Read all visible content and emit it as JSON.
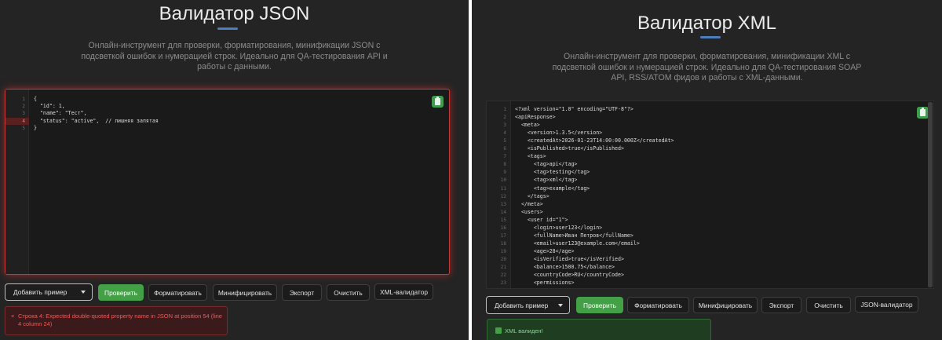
{
  "json_panel": {
    "title": "Валидатор JSON",
    "description_lines": [
      "Онлайн-инструмент для проверки, форматирования, минификации JSON с",
      "подсветкой ошибок и нумерацией строк. Идеально для QA-тестирования API и",
      "работы с данными."
    ],
    "line_numbers": [
      "1",
      "2",
      "3",
      "4",
      "5"
    ],
    "code_lines": [
      "{",
      "  \"id\": 1,",
      "  \"name\": \"Тест\",",
      "  \"status\": \"active\",  // лишняя запятая",
      "}"
    ],
    "error_line": "4",
    "select_label": "Добавить пример",
    "buttons": {
      "validate": "Проверить",
      "format": "Форматировать",
      "minify": "Минифицировать",
      "export": "Экспорт",
      "clear": "Очистить",
      "switch": "XML-валидатор"
    },
    "error_icon": "×",
    "error_lines": [
      "Строка 4: Expected double-quoted property name in JSON at position 54 (line",
      "4 column 24)"
    ]
  },
  "xml_panel": {
    "title": "Валидатор XML",
    "description_lines": [
      "Онлайн-инструмент для проверки, форматирования, минификации XML с",
      "подсветкой ошибок и нумерацией строк. Идеально для QA-тестирования SOAP",
      "API, RSS/ATOM фидов и работы с XML-данными."
    ],
    "line_numbers": [
      "1",
      "2",
      "3",
      "4",
      "5",
      "6",
      "7",
      "8",
      "9",
      "10",
      "11",
      "12",
      "13",
      "14",
      "15",
      "16",
      "17",
      "18",
      "19",
      "20",
      "21",
      "22",
      "23"
    ],
    "code_lines": [
      "<?xml version=\"1.0\" encoding=\"UTF-8\"?>",
      "<apiResponse>",
      "  <meta>",
      "    <version>1.3.5</version>",
      "    <createdAt>2026-01-23T14:00:00.000Z</createdAt>",
      "    <isPublished>true</isPublished>",
      "    <tags>",
      "      <tag>api</tag>",
      "      <tag>testing</tag>",
      "      <tag>xml</tag>",
      "      <tag>example</tag>",
      "    </tags>",
      "  </meta>",
      "  <users>",
      "    <user id=\"1\">",
      "      <login>user123</login>",
      "      <fullName>Иван Петров</fullName>",
      "      <email>user123@example.com</email>",
      "      <age>28</age>",
      "      <isVerified>true</isVerified>",
      "      <balance>1500.75</balance>",
      "      <countryCode>RU</countryCode>",
      "      <permissions>"
    ],
    "select_label": "Добавить пример",
    "buttons": {
      "validate": "Проверить",
      "format": "Форматировать",
      "minify": "Минифицировать",
      "export": "Экспорт",
      "clear": "Очистить",
      "switch": "JSON-валидатор"
    },
    "success_text": "XML валиден!"
  },
  "icons": [
    "copy-icon",
    "chevron-down-icon",
    "error-icon",
    "checkbox-icon"
  ],
  "colors": {
    "accent": "#4e7dbd",
    "success": "#43a047",
    "error": "#c43a3a",
    "background": "#242424"
  }
}
